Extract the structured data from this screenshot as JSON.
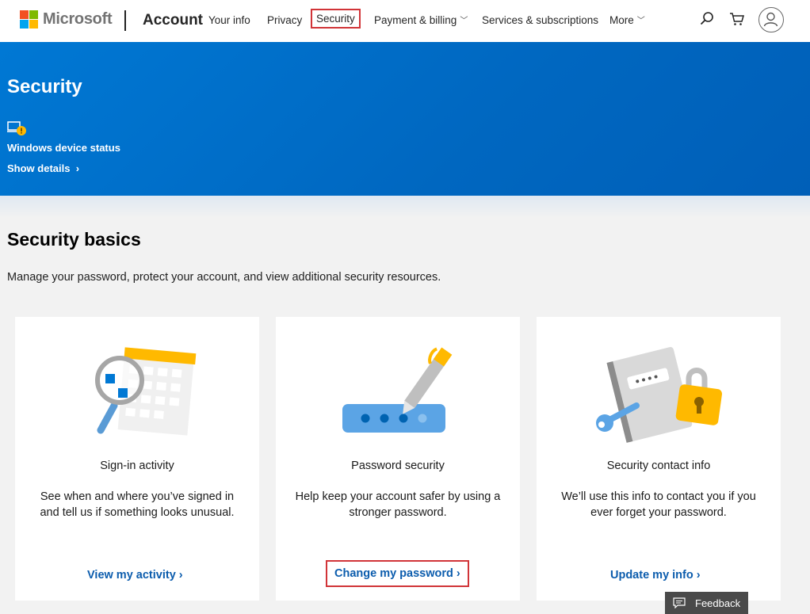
{
  "header": {
    "brand": "Microsoft",
    "section": "Account",
    "nav": [
      {
        "label": "Your info"
      },
      {
        "label": "Privacy"
      },
      {
        "label": "Security"
      },
      {
        "label": "Payment & billing"
      },
      {
        "label": "Services & subscriptions"
      },
      {
        "label": "More"
      }
    ],
    "icons": [
      "search-icon",
      "cart-icon",
      "avatar-icon"
    ],
    "logo_colors": [
      "#f25022",
      "#7fba00",
      "#00a4ef",
      "#ffb900"
    ]
  },
  "hero": {
    "title": "Security",
    "device_status": "Windows device status",
    "show_details": "Show details",
    "accent": "#0078d4"
  },
  "basics": {
    "title": "Security basics",
    "description": "Manage your password, protect your account, and view additional security resources."
  },
  "cards": [
    {
      "title": "Sign-in activity",
      "description": "See when and where you’ve signed in and tell us if something looks unusual.",
      "link": "View my activity"
    },
    {
      "title": "Password security",
      "description": "Help keep your account safer by using a stronger password.",
      "link": "Change my password"
    },
    {
      "title": "Security contact info",
      "description": "We’ll use this info to contact you if you ever forget your password.",
      "link": "Update my info"
    }
  ],
  "feedback": {
    "label": "Feedback"
  }
}
